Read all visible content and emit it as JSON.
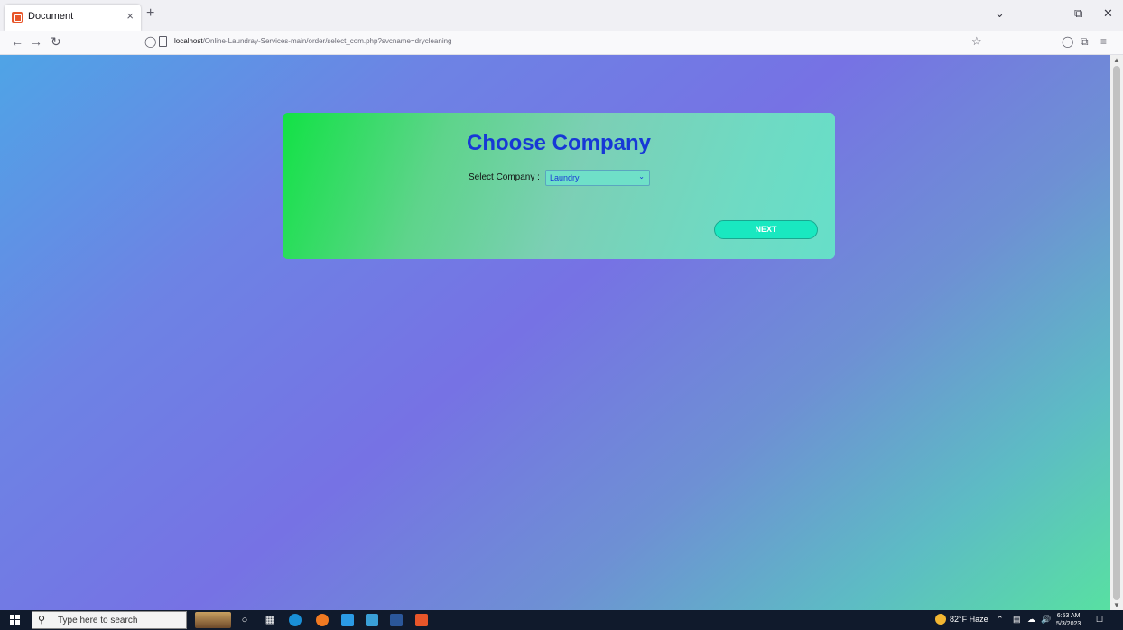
{
  "browser": {
    "tab_title": "Document",
    "tab_close": "×",
    "new_tab": "+",
    "url_host": "localhost",
    "url_path": "/Online-Laundray-Services-main/order/select_com.php?svcname=drycleaning"
  },
  "page": {
    "title": "Choose Company",
    "select_label": "Select Company :",
    "select_value": "Laundry",
    "next_label": "NEXT"
  },
  "taskbar": {
    "search_placeholder": "Type here to search",
    "weather": "82°F  Haze",
    "time": "6:53 AM",
    "date": "5/3/2023"
  },
  "colors": {
    "title": "#1738d6",
    "next_button": "#19e8c0",
    "card_start": "#12e245",
    "card_end": "#66dfc9"
  }
}
